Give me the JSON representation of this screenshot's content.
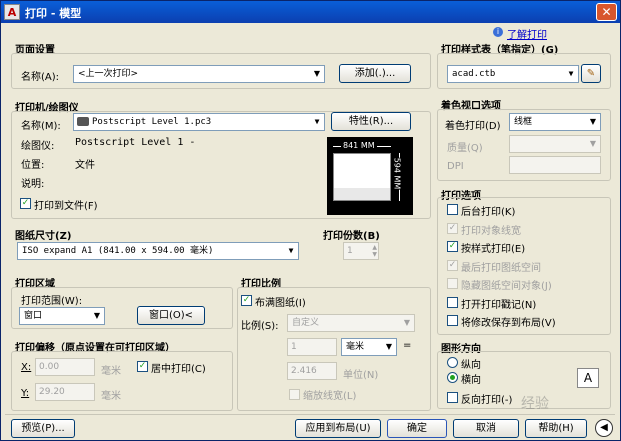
{
  "window": {
    "title": "打印 - 模型",
    "app_icon": "A"
  },
  "help_link": "了解打印",
  "page_setup": {
    "section": "页面设置",
    "name_label": "名称(A):",
    "name_value": "<上一次打印>",
    "add_button": "添加(.)..."
  },
  "printer": {
    "section": "打印机/绘图仪",
    "name_label": "名称(M):",
    "name_value": "Postscript Level 1.pc3",
    "properties_button": "特性(R)...",
    "plotter_label": "绘图仪:",
    "plotter_value": "Postscript Level 1 -",
    "location_label": "位置:",
    "location_value": "文件",
    "desc_label": "说明:",
    "print_to_file": "打印到文件(F)",
    "preview_width": "841 MM",
    "preview_height": "594 MM"
  },
  "paper": {
    "section": "图纸尺寸(Z)",
    "value": "ISO expand A1 (841.00 x 594.00 毫米)"
  },
  "copies": {
    "section": "打印份数(B)",
    "value": "1"
  },
  "plot_area": {
    "section": "打印区域",
    "range_label": "打印范围(W):",
    "range_value": "窗口",
    "window_button": "窗口(O)<"
  },
  "plot_offset": {
    "section": "打印偏移（原点设置在可打印区域）",
    "x_label": "X:",
    "x_value": "0.00",
    "x_unit": "毫米",
    "y_label": "Y:",
    "y_value": "29.20",
    "y_unit": "毫米",
    "center": "居中打印(C)"
  },
  "plot_scale": {
    "section": "打印比例",
    "fit": "布满图纸(I)",
    "scale_label": "比例(S):",
    "scale_value": "自定义",
    "val1": "1",
    "unit_value": "毫米",
    "eq": "=",
    "val2": "2.416",
    "unit_label": "单位(N)",
    "lineweights": "缩放线宽(L)"
  },
  "plot_style": {
    "section": "打印样式表（笔指定）(G)",
    "value": "acad.ctb"
  },
  "shaded": {
    "section": "着色视口选项",
    "shade_label": "着色打印(D)",
    "shade_value": "线框",
    "quality_label": "质量(Q)",
    "dpi_label": "DPI"
  },
  "options": {
    "section": "打印选项",
    "items": [
      {
        "label": "后台打印(K)",
        "checked": false,
        "enabled": true
      },
      {
        "label": "打印对象线宽",
        "checked": true,
        "enabled": false
      },
      {
        "label": "按样式打印(E)",
        "checked": true,
        "enabled": true
      },
      {
        "label": "最后打印图纸空间",
        "checked": true,
        "enabled": false
      },
      {
        "label": "隐藏图纸空间对象(J)",
        "checked": false,
        "enabled": false
      },
      {
        "label": "打开打印戳记(N)",
        "checked": false,
        "enabled": true
      },
      {
        "label": "将修改保存到布局(V)",
        "checked": false,
        "enabled": true
      }
    ]
  },
  "orientation": {
    "section": "图形方向",
    "portrait": "纵向",
    "landscape": "横向",
    "reverse": "反向打印(-)",
    "icon_letter": "A"
  },
  "footer": {
    "preview": "预览(P)...",
    "apply": "应用到布局(U)",
    "ok": "确定",
    "cancel": "取消",
    "help": "帮助(H)",
    "watermark": "经验"
  }
}
